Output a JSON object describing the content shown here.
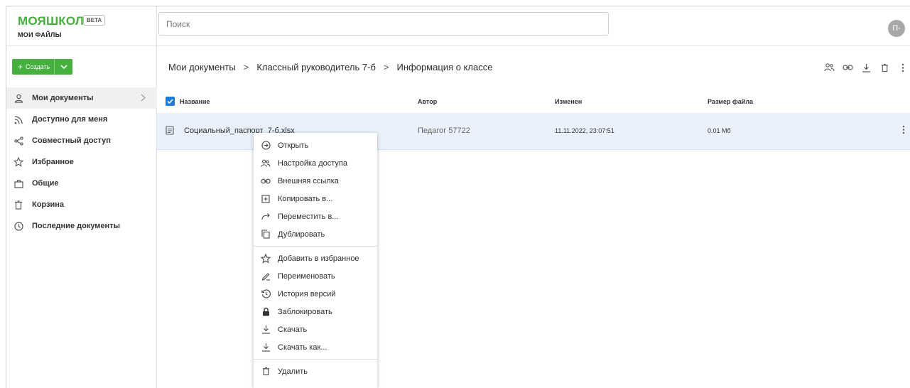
{
  "brand": {
    "logo_text": "МОЯШКОЛА",
    "badge": "BETA",
    "subtitle": "МОИ ФАЙЛЫ",
    "accent_color": "#46b03e"
  },
  "search": {
    "placeholder": "Поиск"
  },
  "user": {
    "avatar_initials": "П-"
  },
  "sidebar": {
    "create_label": "Создать",
    "items": [
      {
        "label": "Мои документы",
        "icon": "person-icon",
        "active": true
      },
      {
        "label": "Доступно для меня",
        "icon": "rss-icon",
        "active": false
      },
      {
        "label": "Совместный доступ",
        "icon": "share-icon",
        "active": false
      },
      {
        "label": "Избранное",
        "icon": "star-icon",
        "active": false
      },
      {
        "label": "Общие",
        "icon": "briefcase-icon",
        "active": false
      },
      {
        "label": "Корзина",
        "icon": "trash-icon",
        "active": false
      },
      {
        "label": "Последние документы",
        "icon": "clock-icon",
        "active": false
      }
    ]
  },
  "breadcrumb": [
    "Мои документы",
    "Классный руководитель 7-б",
    "Информация о классе"
  ],
  "toolbar_icons": [
    "users-icon",
    "link-icon",
    "download-icon",
    "trash-icon",
    "more-vertical-icon"
  ],
  "table": {
    "columns": [
      "Название",
      "Автор",
      "Изменен",
      "Размер файла"
    ],
    "rows": [
      {
        "name": "Социальный_паспорт_7-б.xlsx",
        "author": "Педагог 57722",
        "modified": "11.11.2022, 23:07:51",
        "size": "0.01 Мб"
      }
    ]
  },
  "context_menu": {
    "groups": [
      [
        {
          "label": "Открыть",
          "icon": "open-circle-arrow-icon"
        },
        {
          "label": "Настройка доступа",
          "icon": "users-icon"
        },
        {
          "label": "Внешняя ссылка",
          "icon": "link-icon"
        },
        {
          "label": "Копировать в...",
          "icon": "copy-plus-icon"
        },
        {
          "label": "Переместить в...",
          "icon": "move-arrow-icon"
        },
        {
          "label": "Дублировать",
          "icon": "duplicate-icon"
        }
      ],
      [
        {
          "label": "Добавить в избранное",
          "icon": "star-icon"
        },
        {
          "label": "Переименовать",
          "icon": "pencil-icon"
        },
        {
          "label": "История версий",
          "icon": "history-icon"
        },
        {
          "label": "Заблокировать",
          "icon": "lock-icon"
        },
        {
          "label": "Скачать",
          "icon": "download-icon"
        },
        {
          "label": "Скачать как...",
          "icon": "download-icon"
        }
      ],
      [
        {
          "label": "Удалить",
          "icon": "trash-icon"
        }
      ]
    ]
  }
}
